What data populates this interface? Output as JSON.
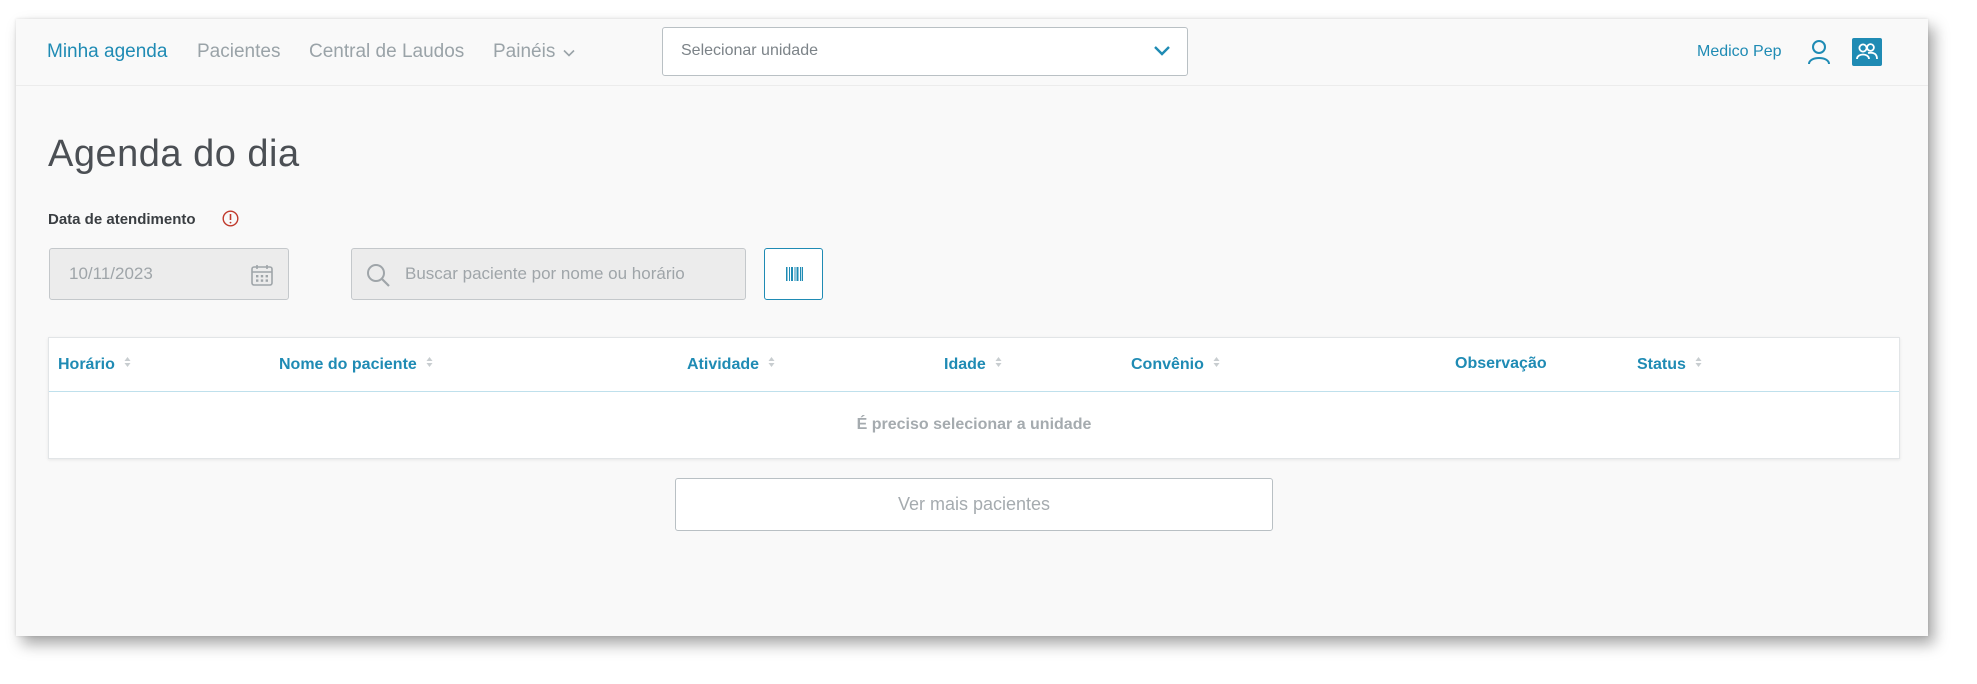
{
  "nav": {
    "items": [
      {
        "label": "Minha agenda",
        "active": true
      },
      {
        "label": "Pacientes",
        "active": false
      },
      {
        "label": "Central de Laudos",
        "active": false
      },
      {
        "label": "Painéis",
        "active": false,
        "has_dropdown": true
      }
    ],
    "unit_select": {
      "placeholder": "Selecionar unidade",
      "icon": "chevron-down-icon"
    },
    "user": {
      "name": "Medico Pep",
      "icon": "user-icon"
    },
    "switch_profile_icon": "users-icon"
  },
  "page": {
    "title": "Agenda do dia",
    "date_label": "Data de atendimento",
    "date_value": "10/11/2023",
    "search_placeholder": "Buscar paciente por nome ou horário",
    "barcode_icon": "barcode-icon"
  },
  "table": {
    "columns": [
      {
        "label": "Horário",
        "sortable": true
      },
      {
        "label": "Nome do paciente",
        "sortable": true
      },
      {
        "label": "Atividade",
        "sortable": true
      },
      {
        "label": "Idade",
        "sortable": true
      },
      {
        "label": "Convênio",
        "sortable": true
      },
      {
        "label": "Observação",
        "sortable": false
      },
      {
        "label": "Status",
        "sortable": true
      }
    ],
    "empty_message": "É preciso selecionar a unidade"
  },
  "actions": {
    "more_label": "Ver mais pacientes"
  },
  "colors": {
    "accent": "#1f8bb4",
    "muted": "#9aa3a8",
    "alert": "#c0392b"
  }
}
